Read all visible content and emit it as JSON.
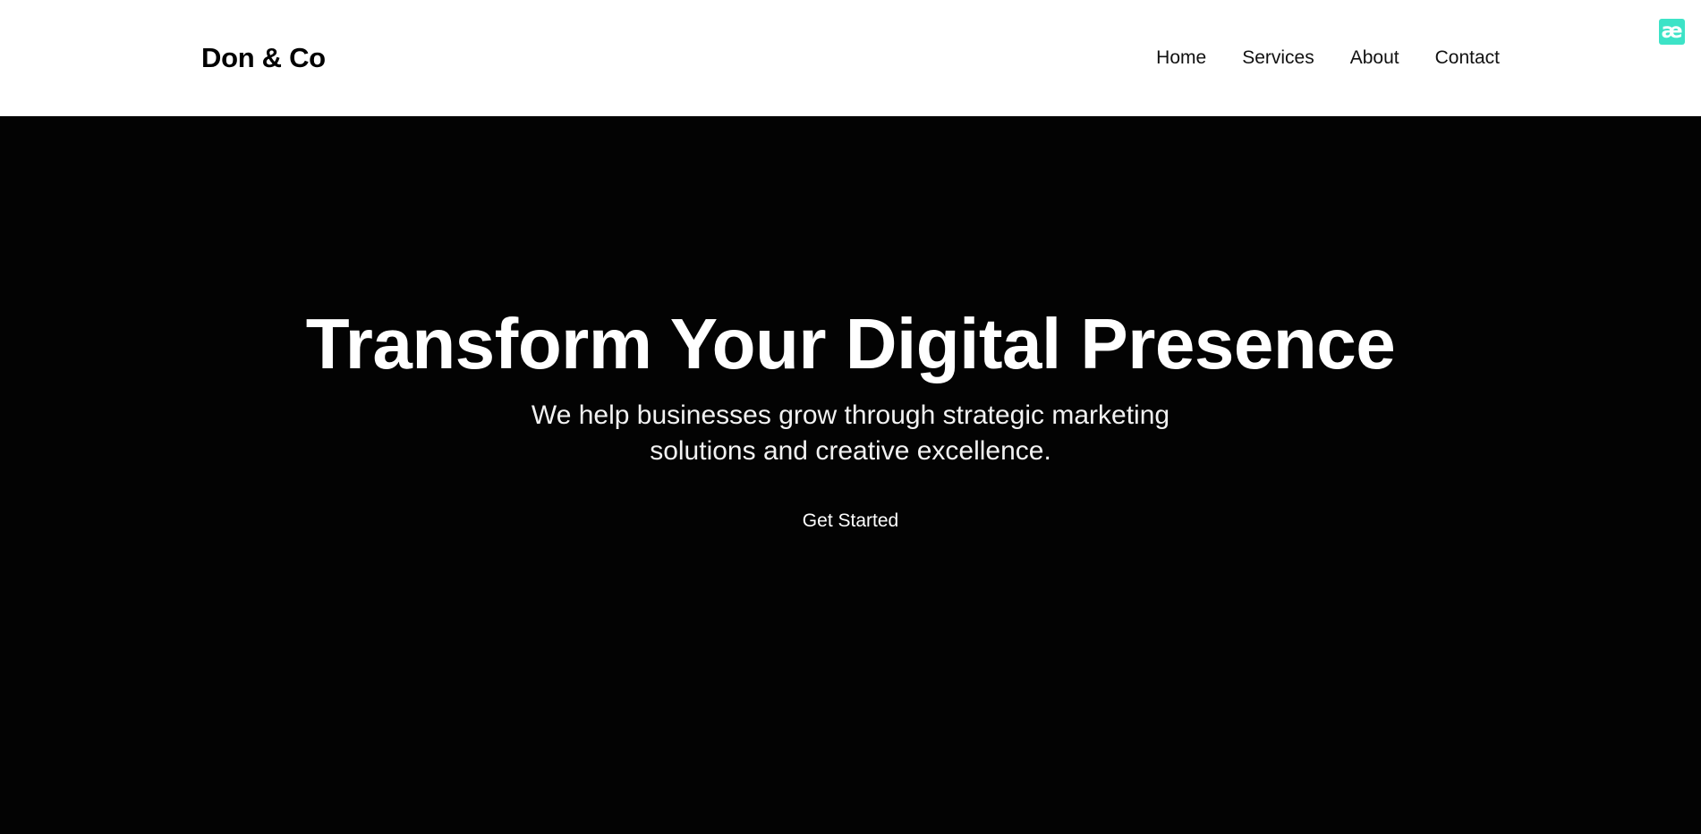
{
  "header": {
    "brand": "Don & Co",
    "nav": [
      {
        "label": "Home"
      },
      {
        "label": "Services"
      },
      {
        "label": "About"
      },
      {
        "label": "Contact"
      }
    ]
  },
  "extension": {
    "glyph": "æ",
    "color": "#3de3c7"
  },
  "hero": {
    "title": "Transform Your Digital Presence",
    "subtitle": "We help businesses grow through strategic marketing solutions and creative excellence.",
    "cta_label": "Get Started",
    "background": "#030303"
  }
}
